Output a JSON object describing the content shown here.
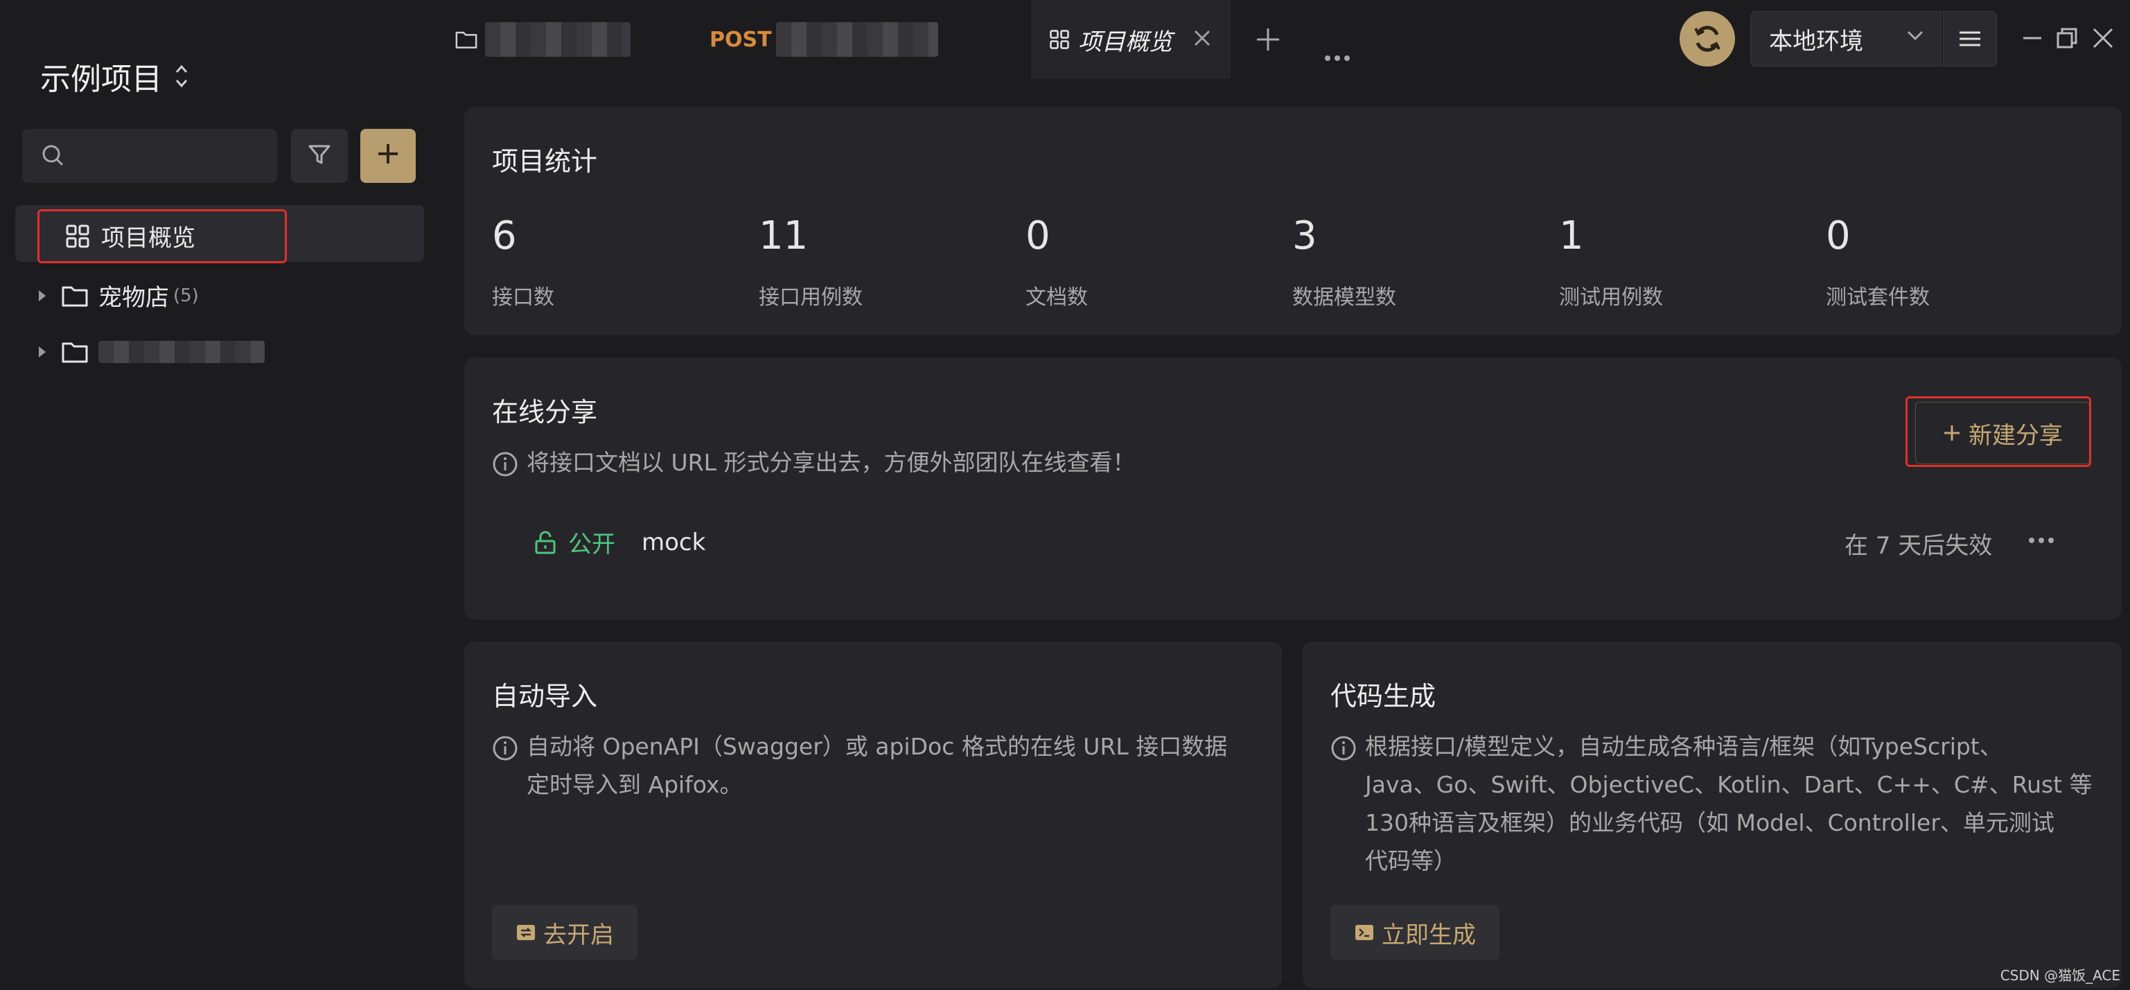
{
  "sidebar": {
    "project_title": "示例项目",
    "tree": [
      {
        "label": "项目概览",
        "selected": true
      },
      {
        "label": "宠物店",
        "count": "(5)"
      },
      {
        "label": ""
      }
    ]
  },
  "tabs": [
    {
      "label": ""
    },
    {
      "method": "POST",
      "label": ""
    },
    {
      "label": "项目概览",
      "active": true
    }
  ],
  "topbar": {
    "environment": "本地环境"
  },
  "stats": {
    "title": "项目统计",
    "items": [
      {
        "value": "6",
        "label": "接口数"
      },
      {
        "value": "11",
        "label": "接口用例数"
      },
      {
        "value": "0",
        "label": "文档数"
      },
      {
        "value": "3",
        "label": "数据模型数"
      },
      {
        "value": "1",
        "label": "测试用例数"
      },
      {
        "value": "0",
        "label": "测试套件数"
      }
    ]
  },
  "share": {
    "title": "在线分享",
    "description": "将接口文档以 URL 形式分享出去，方便外部团队在线查看！",
    "new_button": "新建分享",
    "row": {
      "visibility": "公开",
      "name": "mock",
      "expire": "在 7 天后失效"
    }
  },
  "auto_import": {
    "title": "自动导入",
    "desc_line1": "自动将 OpenAPI（Swagger）或 apiDoc 格式的在线 URL 接口数据",
    "desc_line2": "定时导入到 Apifox。",
    "button": "去开启"
  },
  "codegen": {
    "title": "代码生成",
    "desc_line1": "根据接口/模型定义，自动生成各种语言/框架（如TypeScript、",
    "desc_line2": "Java、Go、Swift、ObjectiveC、Kotlin、Dart、C++、C#、Rust 等",
    "desc_line3": "130种语言及框架）的业务代码（如 Model、Controller、单元测试",
    "desc_line4": "代码等）",
    "button": "立即生成"
  },
  "watermark": "CSDN @猫饭_ACE",
  "colors": {
    "accent": "#b89e6e",
    "public_green": "#4fc67e",
    "post_orange": "#d88a3c",
    "highlight_red": "#e0302a"
  }
}
